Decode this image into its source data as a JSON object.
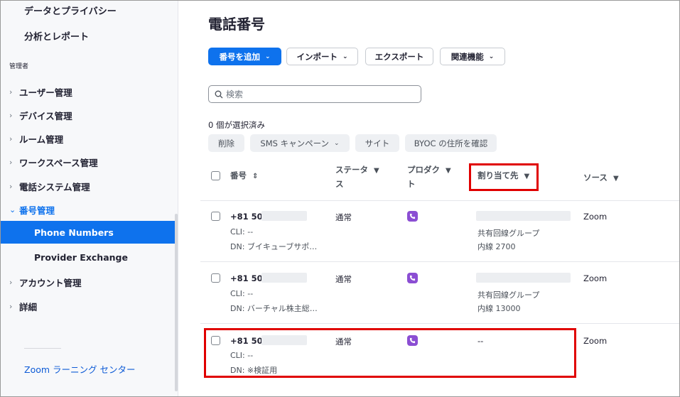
{
  "sidebar": {
    "top_items": [
      "データとプライバシー",
      "分析とレポート"
    ],
    "section_label": "管理者",
    "items": [
      {
        "label": "ユーザー管理",
        "open": false
      },
      {
        "label": "デバイス管理",
        "open": false
      },
      {
        "label": "ルーム管理",
        "open": false
      },
      {
        "label": "ワークスペース管理",
        "open": false
      },
      {
        "label": "電話システム管理",
        "open": false
      },
      {
        "label": "番号管理",
        "open": true
      }
    ],
    "subitems": [
      {
        "label": "Phone Numbers",
        "active": true
      },
      {
        "label": "Provider Exchange",
        "active": false
      }
    ],
    "items_after": [
      "アカウント管理",
      "詳細"
    ],
    "footer_link": "Zoom ラーニング センター"
  },
  "page": {
    "title": "電話番号",
    "toolbar": {
      "add_number": "番号を追加",
      "import": "インポート",
      "export": "エクスポート",
      "related": "関連機能"
    },
    "search_placeholder": "検索",
    "selected_count": "0 個が選択済み",
    "bulk_actions": {
      "delete": "削除",
      "sms_campaign": "SMS キャンペーン",
      "site": "サイト",
      "byoc": "BYOC の住所を確認"
    }
  },
  "table": {
    "columns": {
      "number": "番号",
      "status_line1": "ステータ",
      "status_line2": "ス",
      "product_line1": "プロダク",
      "product_line2": "ト",
      "assignee": "割り当て先",
      "source": "ソース"
    },
    "rows": [
      {
        "number": "+81 50",
        "cli": "CLI: --",
        "dn": "DN: ブイキューブサポ…",
        "status": "通常",
        "assignee_line1": "共有回線グループ",
        "assignee_line2": "内線 2700",
        "source": "Zoom"
      },
      {
        "number": "+81 50",
        "cli": "CLI: --",
        "dn": "DN: バーチャル株主総…",
        "status": "通常",
        "assignee_line1": "共有回線グループ",
        "assignee_line2": "内線 13000",
        "source": "Zoom"
      },
      {
        "number": "+81 50",
        "cli": "CLI: --",
        "dn": "DN: ※検証用",
        "status": "通常",
        "assignee_line1": "--",
        "assignee_line2": "",
        "source": "Zoom"
      }
    ]
  },
  "colors": {
    "accent": "#0e72ed",
    "highlight": "#e00000",
    "phone_icon": "#8b4ed3"
  }
}
